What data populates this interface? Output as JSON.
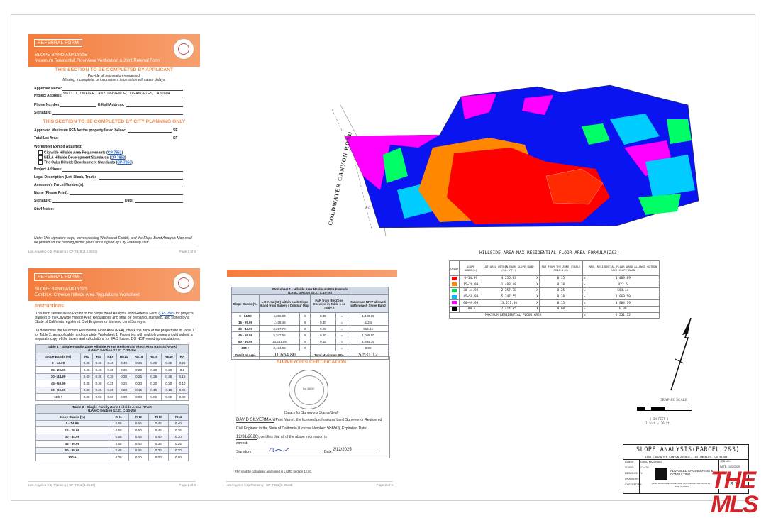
{
  "referral": {
    "tag": "REFERRAL FORM",
    "title": "SLOPE BAND ANALYSIS",
    "subtitle": "Maximum Residential Floor Area Verification & Joint Referral Form",
    "applicant_heading": "THIS SECTION TO BE COMPLETED BY APPLICANT",
    "note1": "Provide all information requested.",
    "note2": "Missing, incomplete, or inconsistent information will cause delays.",
    "applicant_name_label": "Applicant Name:",
    "project_address_label": "Project Address:",
    "project_address": "3351 COLD WATER CANYON AVENUE, LOS ANGELES, CA 91604",
    "phone_label": "Phone Number:",
    "email_label": "E-Mail Address:",
    "signature_label": "Signature:",
    "city_heading": "THIS SECTION TO BE COMPLETED BY CITY PLANNING ONLY",
    "approved_label": "Approved Maximum RFA for the property listed below:",
    "sf1": "SF",
    "total_lot_label": "Total Lot Area:",
    "sf2": "SF",
    "worksheet_label": "Worksheet Exhibit Attached:",
    "opt1": "Citywide Hillside Area Requirements (",
    "opt1_link": "CP-7851",
    "opt2": "NELA Hillside Development Standards (",
    "opt2_link": "CP-7852",
    "opt3": "The Oaks Hillside Development Standards (",
    "opt3_link": "CP-7853",
    "close": ")",
    "proj_addr2_label": "Project Address:",
    "legal_label": "Legal Description (Lot, Block, Tract):",
    "apn_label": "Assessor's Parcel Number(s):",
    "name_label": "Name (Please Print):",
    "sig2_label": "Signature:",
    "date_label": "Date:",
    "staff_label": "Staff Notes:",
    "bottom_note": "Note: This signature page, corresponding Worksheet Exhibit, and the Slope Band Analysis Map shall be printed on the building permit plans once signed by City Planning staff.",
    "footer_left": "Los Angeles City Planning  |  CP-7848 [4.4.2023]",
    "footer_right": "Page 3 of 3"
  },
  "exhibit": {
    "tag": "REFERRAL FORM",
    "title": "SLOPE BAND ANALYSIS",
    "subtitle": "Exhibit A: Citywide Hillside Area Regulations Worksheet",
    "instructions_heading": "Instructions",
    "para1_a": "This form serves as an Exhibit to the Slope Band Analysis Joint Referral Form (",
    "para1_link": "CP-7848",
    "para1_b": ") for projects subject to the Citywide Hillside Area Regulations and shall be prepared, stamped, and signed by a State of California registered Civil Engineer or licensed Land Surveyor.",
    "para2": "To determine the Maximum Residential Floor Area (RFA), check the zone of the project site in Table 1 or Table 2, as applicable, and complete Worksheet 1. Properties with multiple zones should submit a separate copy of the tables and calculations for EACH zone. DO NOT round up calculations.",
    "footer_left": "Los Angeles City Planning  |  CP-7851 [3.28.23]",
    "footer_right": "Page 1 of 2"
  },
  "table1": {
    "caption1": "Table 1 - Single-Family Zone Hillside Areas Residential Floor Area Ratios (RFAR)",
    "caption2": "(LAMC Section 12.21 C.10-2a)",
    "headers": [
      "Slope Bands (%)",
      "R1",
      "RS",
      "RE9",
      "RE11",
      "RE15",
      "RE20",
      "RE40",
      "RA"
    ],
    "rows": [
      [
        "0 - 14.99",
        "0.45",
        "0.45",
        "0.40",
        "0.40",
        "0.35",
        "0.35",
        "0.35",
        "0.25"
      ],
      [
        "15 - 29.99",
        "0.45",
        "0.40",
        "0.35",
        "0.35",
        "0.30",
        "0.30",
        "0.30",
        "0.2"
      ],
      [
        "30 - 44.99",
        "0.40",
        "0.35",
        "0.30",
        "0.30",
        "0.25",
        "0.25",
        "0.25",
        "0.15"
      ],
      [
        "45 - 59.99",
        "0.35",
        "0.30",
        "0.25",
        "0.25",
        "0.20",
        "0.20",
        "0.20",
        "0.10"
      ],
      [
        "60 - 99.99",
        "0.30",
        "0.25",
        "0.20",
        "0.20",
        "0.15",
        "0.15",
        "0.15",
        "0.05"
      ],
      [
        "100 +",
        "0.00",
        "0.00",
        "0.00",
        "0.00",
        "0.00",
        "0.00",
        "0.00",
        "0.00"
      ]
    ]
  },
  "table2": {
    "caption1": "Table 2 - Single-Family Zone Hillside Areas RFAR",
    "caption2": "(LAMC Section 12.21 C.10-2b)",
    "headers": [
      "Slope Bands (%)",
      "RH1",
      "RH2",
      "RH3",
      "RH4"
    ],
    "rows": [
      [
        "0 - 14.99",
        "0.65",
        "0.55",
        "0.45",
        "0.40"
      ],
      [
        "15 - 29.99",
        "0.60",
        "0.50",
        "0.45",
        "0.35"
      ],
      [
        "30 - 44.99",
        "0.55",
        "0.45",
        "0.40",
        "0.30"
      ],
      [
        "45 - 59.99",
        "0.50",
        "0.40",
        "0.35",
        "0.25"
      ],
      [
        "60 - 99.99",
        "0.45",
        "0.35",
        "0.30",
        "0.20"
      ],
      [
        "100 +",
        "0.00",
        "0.00",
        "0.00",
        "0.00"
      ]
    ]
  },
  "worksheet": {
    "caption1": "Worksheet 1 - Hillside Area Maximum RFA Formula",
    "caption2": "(LAMC Section 12.21 C.10-2c)",
    "h1": "Slope Bands (%)",
    "h2": "Lot Area (SF) within each Slope Band from Survey / Contour Map",
    "h3": "FAR from the Zone Checked in Table 1 or Table 2",
    "h4": "Maximum RFA* allowed within each Slope Band",
    "rows": [
      [
        "0 - 14.99",
        "4,256.83",
        "X",
        "0.35",
        "=",
        "1,489.89"
      ],
      [
        "15 - 29.99",
        "1,408.48",
        "X",
        "0.30",
        "=",
        "422.5"
      ],
      [
        "30 - 44.99",
        "2,257.78",
        "X",
        "0.25",
        "=",
        "564.44"
      ],
      [
        "45 - 59.99",
        "5,347.55",
        "X",
        "0.20",
        "=",
        "1,069.50"
      ],
      [
        "60 - 99.99",
        "13,231.96",
        "X",
        "0.15",
        "=",
        "1,984.79"
      ],
      [
        "100 +",
        "2,414.95",
        "X",
        "",
        "=",
        "0.00"
      ]
    ],
    "total_lot_label": "Total Lot Area",
    "total_lot": "11,654.80",
    "total_rfa_label": "Total Maximum RFA",
    "total_rfa": "5,531.12",
    "surveyor_heading": "SURVEYOR'S CERTIFICATION",
    "stamp_caption": "(Space for Surveyor's Stamp/Seal)",
    "surveyor_name": "DAVID SILVERMAN",
    "cert_a": "(Print Name), the licensed professional Land Surveyor or Registered",
    "cert_b": "Civil Engineer in the State of California (License Number:",
    "license": "58650",
    "cert_c": "), Expiration Date:",
    "expiration": "12/31/2026",
    "cert_d": "), certifies that all of the above information is",
    "cert_e": "correct.",
    "signature_label": "Signature:",
    "date_label": "Date:",
    "date": "2/12/2025",
    "footnote": "* RFA shall be calculated as defined in LAMC Section 12.03.",
    "footer_left": "Los Angeles City Planning  |  CP-7851 [3.28.23]",
    "footer_right": "Page 2 of 2"
  },
  "map": {
    "road_label": "COLDWATER CANYON ROAD",
    "ac_label": "A.C.",
    "colors": {
      "band1": "#ff0000",
      "band2": "#ff6600",
      "band3": "#00ff66",
      "band4": "#00ccff",
      "band5": "#0000ff",
      "band6": "#ff00ff"
    }
  },
  "hillside": {
    "title": "HILLSIDE AREA MAX RESIDENTIAL FLOOR AREA FORMULA(2&3)",
    "headers": [
      "COLOR",
      "SLOPE BANDS(%)",
      "LOT AREA WITHIN EACH SLOPE BAND (SQ. FT.)",
      "",
      "FAR FROM THE ZONE (TABLE RE40-1-H)",
      "",
      "MAX. RESIDENTIAL FLOOR AREA ALLOWED WITHIN EACH SLOPE BAND"
    ],
    "rows": [
      {
        "color": "#ff0000",
        "band": "0~14.99",
        "area": "4,256.83",
        "x": "X",
        "far": "0.35",
        "eq": "=",
        "max": "1,489.89"
      },
      {
        "color": "#ff8800",
        "band": "15~29.99",
        "area": "1,408.48",
        "x": "X",
        "far": "0.30",
        "eq": "=",
        "max": "422.5"
      },
      {
        "color": "#00dd55",
        "band": "30~44.99",
        "area": "2,257.78",
        "x": "X",
        "far": "0.25",
        "eq": "=",
        "max": "564.44"
      },
      {
        "color": "#00bbff",
        "band": "45~59.99",
        "area": "5,347.55",
        "x": "X",
        "far": "0.20",
        "eq": "=",
        "max": "1,069.50"
      },
      {
        "color": "#ff00ff",
        "band": "60~99.99",
        "area": "13,231.96",
        "x": "X",
        "far": "0.15",
        "eq": "=",
        "max": "1,984.79"
      },
      {
        "color": "#000000",
        "band": "100 +",
        "area": "2,414.95",
        "x": "X",
        "far": "0.00",
        "eq": "=",
        "max": "0.00"
      }
    ],
    "total_label": "MAXIMUM RESIDENTIAL FLOOR AREA",
    "total_eq": "=",
    "total": "5,531.12"
  },
  "graphic_scale": {
    "label": "GRAPHIC SCALE",
    "units": "( IN FEET )",
    "ratio": "1 inch = 20 ft."
  },
  "title_block": {
    "title": "SLOPE ANALYSIS(PARCEL 2&3)",
    "address": "3351 COLDWATER CANYON AVENUE, LOS ANGELES, CA 91604",
    "client_label": "CLIENT:",
    "client": "DAVID KAZARIAN",
    "scale_label": "SCALE:",
    "scale": "1\" = 20'",
    "designed_label": "DESIGNED BY:",
    "drawn_label": "DRAWN BY:",
    "checked_label": "CHECKED BY:",
    "company": "ADVANCED ENGINEERING & CONSULTING",
    "company_addr": "28110 ROADSIDE DRIVE, Suite 305, AGOURA HILLS, CA 91",
    "company_phone": "(818) 222-7982",
    "job_label": "JOB NO.:",
    "date_label": "DATE:",
    "date": "1/22/2025",
    "sheet": "S.1"
  },
  "watermark": {
    "text": "THE MLS"
  }
}
